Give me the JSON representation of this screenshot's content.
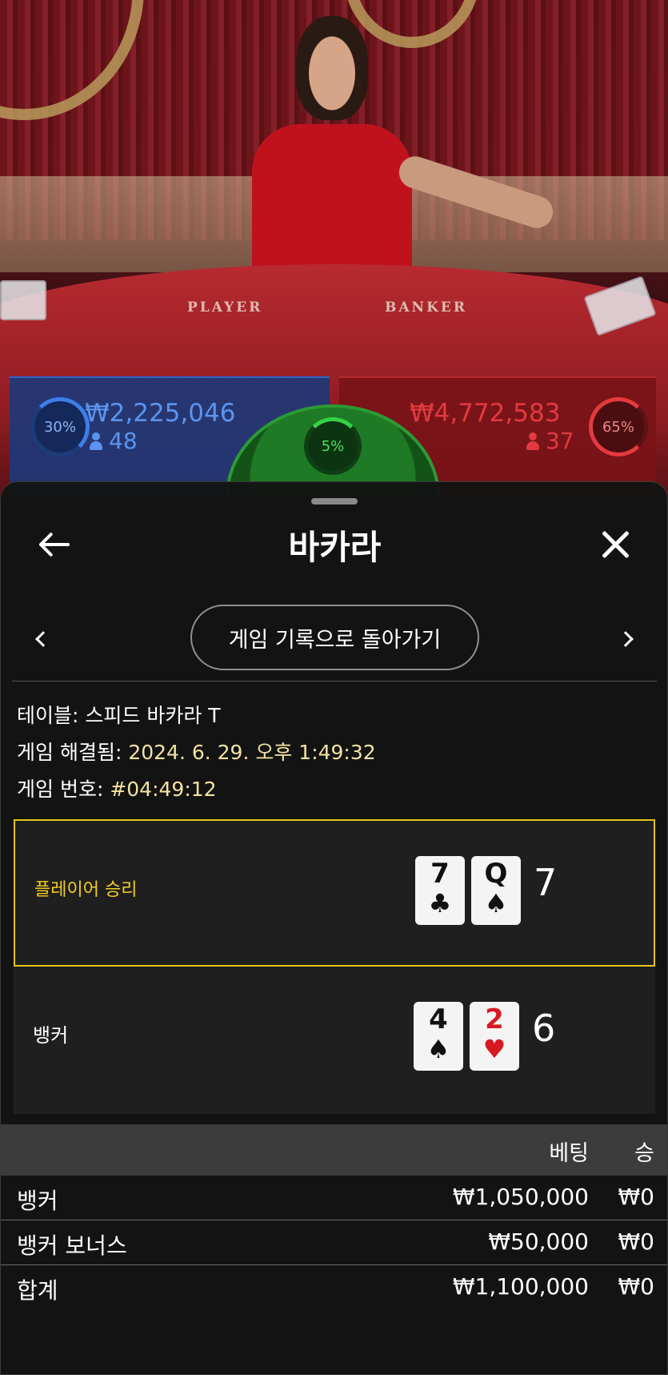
{
  "table_labels": {
    "player": "PLAYER",
    "banker": "BANKER"
  },
  "player_bets": {
    "percent": "30%",
    "amount": "₩2,225,046",
    "count": "48"
  },
  "banker_bets": {
    "percent": "65%",
    "amount": "₩4,772,583",
    "count": "37"
  },
  "tie_bets": {
    "percent": "5%"
  },
  "sheet": {
    "title": "바카라",
    "back_to_history": "게임 기록으로 돌아가기",
    "table_label": "테이블:",
    "table_value": "스피드 바카라 T",
    "resolved_label": "게임 해결됨:",
    "resolved_value": "2024. 6. 29. 오후 1:49:32",
    "game_no_label": "게임 번호:",
    "game_no_value": "#04:49:12"
  },
  "results": [
    {
      "label": "플레이어 승리",
      "cards": [
        {
          "rank": "7",
          "suit": "♣",
          "color": "black"
        },
        {
          "rank": "Q",
          "suit": "♠",
          "color": "black"
        }
      ],
      "score": "7"
    },
    {
      "label": "뱅커",
      "cards": [
        {
          "rank": "4",
          "suit": "♠",
          "color": "black"
        },
        {
          "rank": "2",
          "suit": "♥",
          "color": "red"
        }
      ],
      "score": "6"
    }
  ],
  "bets_table": {
    "col_bet": "베팅",
    "col_win": "승",
    "rows": [
      {
        "name": "뱅커",
        "bet": "₩1,050,000",
        "win": "₩0"
      },
      {
        "name": "뱅커 보너스",
        "bet": "₩50,000",
        "win": "₩0"
      },
      {
        "name": "합계",
        "bet": "₩1,100,000",
        "win": "₩0"
      }
    ]
  },
  "colors": {
    "accent_gold": "#e4c41a",
    "player_blue": "#5b94f0",
    "banker_red": "#e23a40",
    "tie_green": "#4ee05a"
  }
}
